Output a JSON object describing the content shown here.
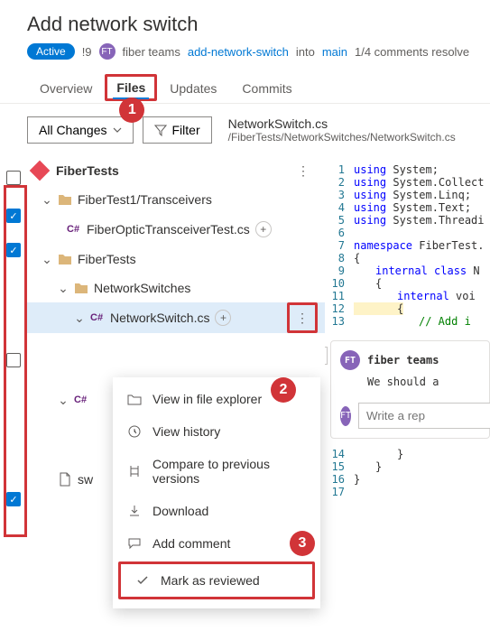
{
  "header": {
    "title": "Add network switch",
    "status": "Active",
    "pr_number": "!9",
    "author_initials": "FT",
    "author": "fiber teams",
    "source_branch": "add-network-switch",
    "into_label": "into",
    "target_branch": "main",
    "comment_status": "1/4 comments resolve"
  },
  "tabs": {
    "overview": "Overview",
    "files": "Files",
    "updates": "Updates",
    "commits": "Commits"
  },
  "toolbar": {
    "all_changes": "All Changes",
    "filter": "Filter",
    "current_file": "NetworkSwitch.cs",
    "current_path": "/FiberTests/NetworkSwitches/NetworkSwitch.cs"
  },
  "tree": {
    "root": "FiberTests",
    "folder1": "FiberTest1/Transceivers",
    "file1": "FiberOpticTransceiverTest.cs",
    "folder2": "FiberTests",
    "folder3": "NetworkSwitches",
    "file2": "NetworkSwitch.cs",
    "file3": "C#",
    "file4": "sw"
  },
  "menu": {
    "view_explorer": "View in file explorer",
    "view_history": "View history",
    "compare": "Compare to previous versions",
    "download": "Download",
    "add_comment": "Add comment",
    "mark_reviewed": "Mark as reviewed"
  },
  "code": {
    "l1": "using System;",
    "l2": "using System.Collect",
    "l3": "using System.Linq;",
    "l4": "using System.Text;",
    "l5": "using System.Threadi",
    "l7": "namespace FiberTest.",
    "l8": "{",
    "l9": "internal class N",
    "l10": "{",
    "l11": "internal voi",
    "l12": "{",
    "l13": "// Add i",
    "l14": "}",
    "l15": "}",
    "l16": "}"
  },
  "comments": {
    "author_initials": "FT",
    "author": "fiber teams",
    "body": "We should a",
    "reply_placeholder": "Write a rep"
  },
  "callouts": {
    "c1": "1",
    "c2": "2",
    "c3": "3"
  }
}
